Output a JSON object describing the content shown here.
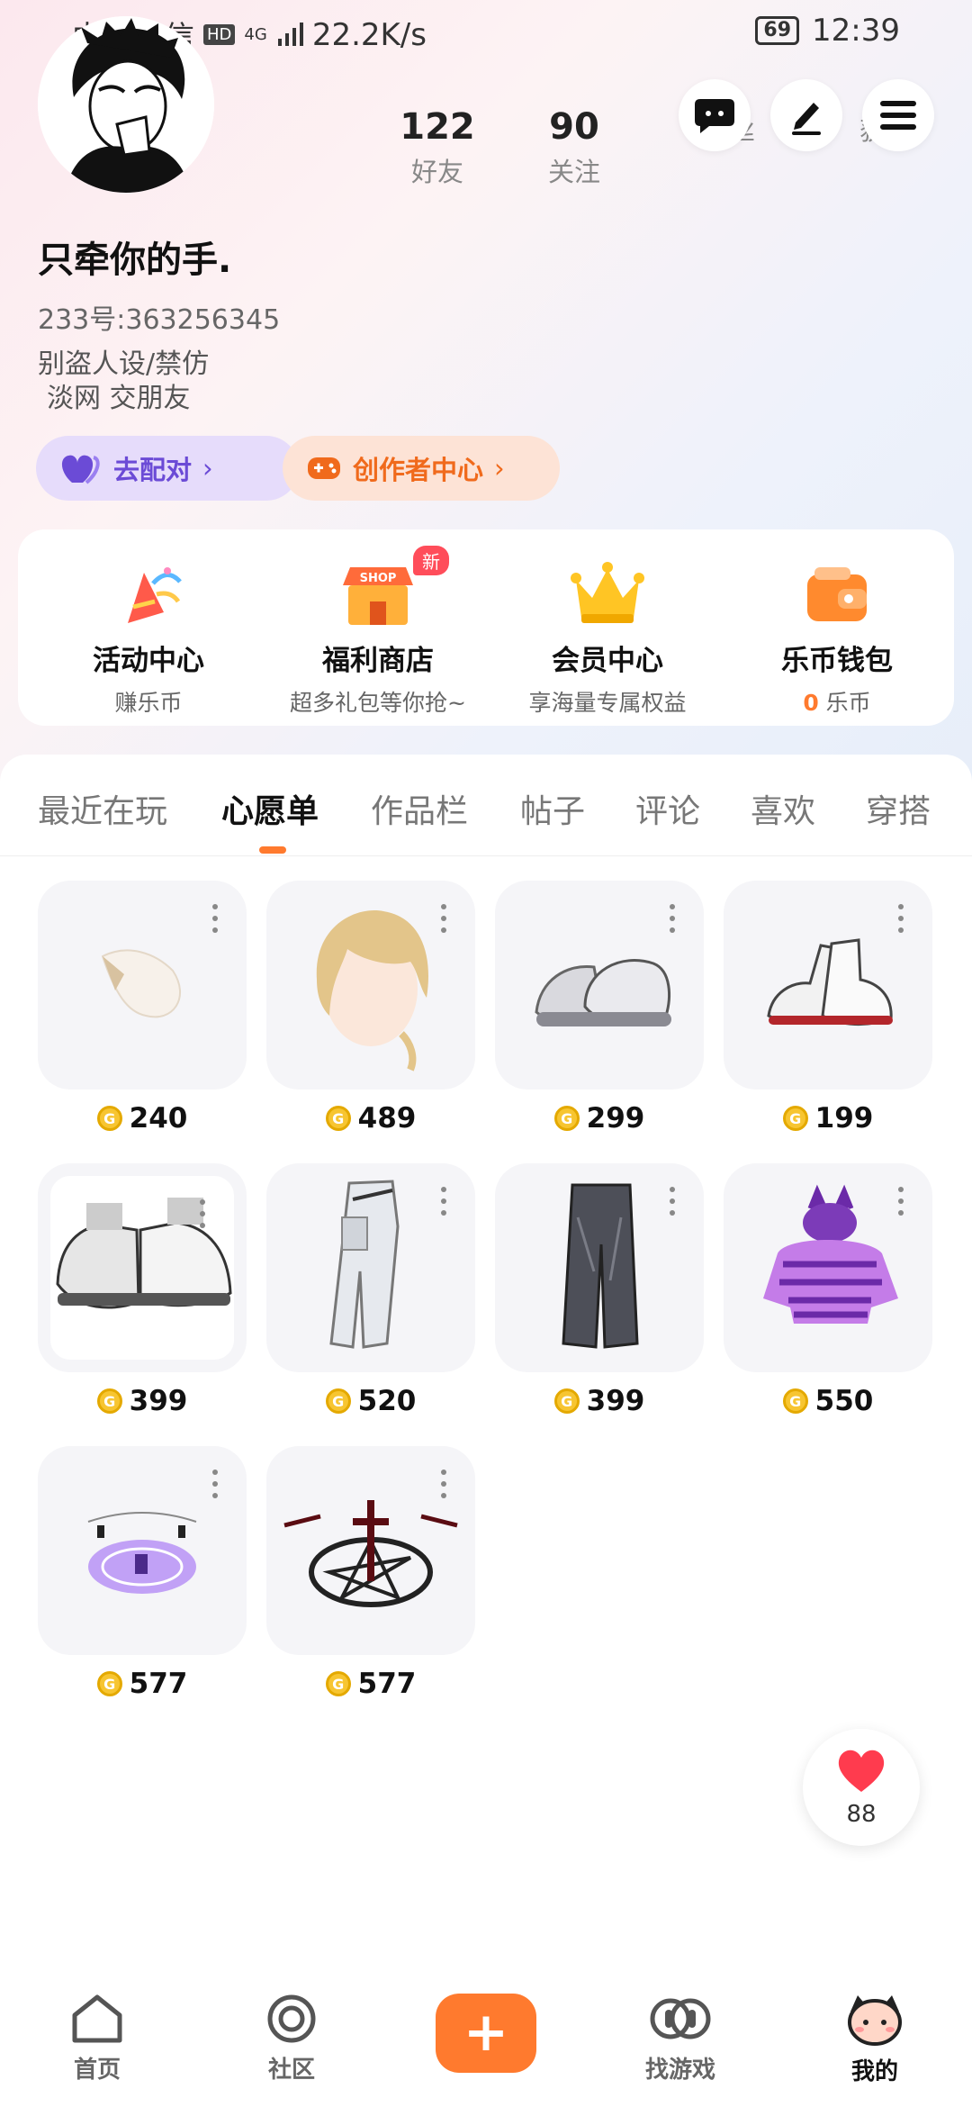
{
  "status_bar": {
    "carrier": "中国电信",
    "network": "4G",
    "speed": "22.2K/s",
    "battery": "69",
    "time": "12:39"
  },
  "profile": {
    "name": "只牵你的手.",
    "id_line": "233号:363256345",
    "bio_line1": "别盗人设/禁仿",
    "bio_line2": "淡网 交朋友",
    "stats": [
      {
        "value": "122",
        "label": "好友"
      },
      {
        "value": "90",
        "label": "关注"
      },
      {
        "value": "",
        "label": "粉丝"
      },
      {
        "value": "",
        "label": "获赞"
      }
    ]
  },
  "header_icons": [
    "chat-icon",
    "edit-icon",
    "menu-icon"
  ],
  "pills": {
    "match_label": "去配对",
    "creator_label": "创作者中心"
  },
  "quick_cards": [
    {
      "icon": "party-icon",
      "title": "活动中心",
      "subtitle": "赚乐币"
    },
    {
      "icon": "shop-icon",
      "title": "福利商店",
      "subtitle": "超多礼包等你抢~",
      "badge": "新",
      "sign": "SHOP"
    },
    {
      "icon": "crown-icon",
      "title": "会员中心",
      "subtitle": "享海量专属权益"
    },
    {
      "icon": "wallet-icon",
      "title": "乐币钱包",
      "balance": "0",
      "unit": "乐币"
    }
  ],
  "tabs": [
    "最近在玩",
    "心愿单",
    "作品栏",
    "帖子",
    "评论",
    "喜欢",
    "穿搭"
  ],
  "active_tab": "心愿单",
  "wishlist": [
    {
      "name": "white-scarf-item",
      "price": "240"
    },
    {
      "name": "blonde-hair-item",
      "price": "489"
    },
    {
      "name": "gray-chunky-sneakers",
      "price": "299"
    },
    {
      "name": "white-high-sneakers",
      "price": "199"
    },
    {
      "name": "gray-low-sneakers",
      "price": "399"
    },
    {
      "name": "white-cargo-pants",
      "price": "520"
    },
    {
      "name": "gray-jeans",
      "price": "399"
    },
    {
      "name": "purple-striped-hoodie",
      "price": "550"
    },
    {
      "name": "purple-magic-circle",
      "price": "577"
    },
    {
      "name": "dark-pentagram-effect",
      "price": "577"
    }
  ],
  "coin_symbol": "G",
  "fab": {
    "count": "88"
  },
  "bottom_nav": [
    {
      "label": "首页"
    },
    {
      "label": "社区"
    },
    {
      "label": "+"
    },
    {
      "label": "找游戏"
    },
    {
      "label": "我的"
    }
  ],
  "colors": {
    "accent": "#ff7a2e",
    "purple": "#6b4bd6",
    "coin": "#f7c531"
  }
}
